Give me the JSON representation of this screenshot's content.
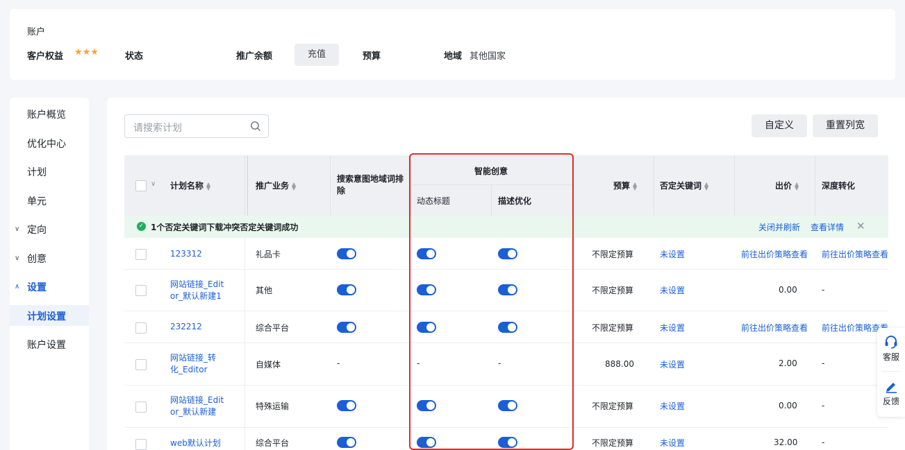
{
  "account": {
    "title": "账户",
    "rights_label": "客户权益",
    "stars": "★★★",
    "status_label": "状态",
    "balance_label": "推广余额",
    "recharge_label": "充值",
    "budget_label": "预算",
    "region_label": "地域",
    "region_value": "其他国家"
  },
  "sidebar": {
    "items": [
      {
        "label": "账户概览"
      },
      {
        "label": "优化中心"
      },
      {
        "label": "计划"
      },
      {
        "label": "单元"
      },
      {
        "label": "定向"
      },
      {
        "label": "创意"
      },
      {
        "label": "设置"
      },
      {
        "label": "计划设置"
      },
      {
        "label": "账户设置"
      }
    ]
  },
  "toolbar": {
    "search_placeholder": "请搜索计划",
    "custom_label": "自定义",
    "reset_label": "重置列宽"
  },
  "table": {
    "headers": {
      "name": "计划名称",
      "business": "推广业务",
      "exclude": "搜索意图地域词排除",
      "smart_group": "智能创意",
      "dynamic_title": "动态标题",
      "desc_opt": "描述优化",
      "budget": "预算",
      "neg_kw": "否定关键词",
      "bid": "出价",
      "deep": "深度转化"
    },
    "notice": {
      "text": "1个否定关键词下载冲突否定关键词成功",
      "close_refresh": "关闭并刷新",
      "view_detail": "查看详情"
    },
    "rows": [
      {
        "name": "123312",
        "business": "礼品卡",
        "exclude": "on",
        "dyn": "on",
        "desc": "on",
        "budget": "不限定预算",
        "neg": "未设置",
        "bid": "前往出价策略查看",
        "deep": "前往出价策略查看"
      },
      {
        "name": "网站链接_Editor_默认新建1",
        "name1": "网站链接_Edit",
        "name2": "or_默认新建1",
        "business": "其他",
        "exclude": "on",
        "dyn": "on",
        "desc": "on",
        "budget": "不限定预算",
        "neg": "未设置",
        "bid": "0.00",
        "deep": "-"
      },
      {
        "name": "232212",
        "business": "综合平台",
        "exclude": "on",
        "dyn": "on",
        "desc": "on",
        "budget": "不限定预算",
        "neg": "未设置",
        "bid": "前往出价策略查看",
        "deep": "前往出价策略查看"
      },
      {
        "name": "网站链接_转化_Editor",
        "name1": "网站链接_转",
        "name2": "化_Editor",
        "business": "自媒体",
        "exclude": "-",
        "dyn": "-",
        "desc": "-",
        "budget": "888.00",
        "neg": "未设置",
        "bid": "2.00",
        "deep": "-"
      },
      {
        "name": "网站链接_Editor_默认新建",
        "name1": "网站链接_Edit",
        "name2": "or_默认新建",
        "business": "特殊运输",
        "exclude": "on",
        "dyn": "on",
        "desc": "on",
        "budget": "不限定预算",
        "neg": "未设置",
        "bid": "0.00",
        "deep": "-"
      },
      {
        "name": "web默认计划",
        "business": "综合平台",
        "exclude": "on",
        "dyn": "on",
        "desc": "on",
        "budget": "不限定预算",
        "neg": "未设置",
        "bid": "32.00",
        "deep": "-"
      }
    ]
  },
  "float": {
    "service_label": "客服",
    "feedback_label": "反馈"
  },
  "colors": {
    "accent": "#1a5fd6",
    "highlight": "#e02a2a",
    "star": "#f5a623",
    "success": "#1fae5e"
  }
}
